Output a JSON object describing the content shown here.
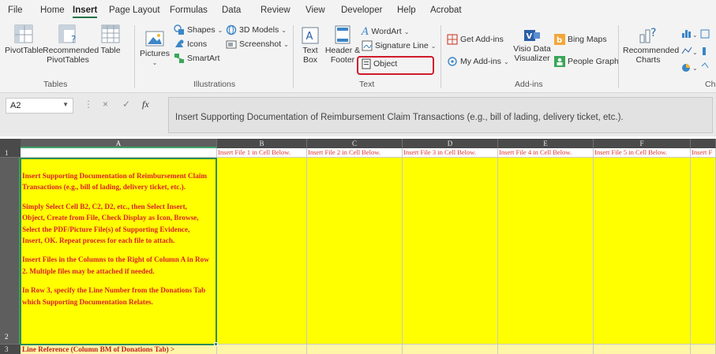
{
  "ribbon_tabs": [
    "File",
    "Home",
    "Insert",
    "Page Layout",
    "Formulas",
    "Data",
    "Review",
    "View",
    "Developer",
    "Help",
    "Acrobat"
  ],
  "active_tab": "Insert",
  "groups": {
    "tables": {
      "label": "Tables",
      "pivottable": "PivotTable",
      "recommended_pivot": "Recommended PivotTables",
      "table": "Table"
    },
    "illustrations": {
      "label": "Illustrations",
      "pictures": "Pictures",
      "shapes": "Shapes",
      "icons": "Icons",
      "models": "3D Models",
      "smartart": "SmartArt",
      "screenshot": "Screenshot"
    },
    "text": {
      "label": "Text",
      "textbox": "Text Box",
      "header_footer": "Header & Footer",
      "wordart": "WordArt",
      "signature_line": "Signature Line",
      "object": "Object"
    },
    "addins": {
      "label": "Add-ins",
      "get_addins": "Get Add-ins",
      "my_addins": "My Add-ins",
      "visio": "Visio Data Visualizer",
      "bing_maps": "Bing Maps",
      "people_graph": "People Graph"
    },
    "charts": {
      "label": "Ch",
      "recommended_charts": "Recommended Charts"
    }
  },
  "name_box": "A2",
  "formula_bar": {
    "cancel": "×",
    "enter": "✓",
    "fx": "fx",
    "content": "Insert Supporting Documentation of  Reimbursement Claim Transactions (e.g., bill of lading, delivery ticket, etc.)."
  },
  "sheet": {
    "column_headers": [
      "A",
      "B",
      "C",
      "D",
      "E",
      "F"
    ],
    "row_headers": [
      "1",
      "2",
      "3"
    ],
    "row1": [
      "",
      "Insert File 1 in Cell Below.",
      "Insert File 2 in Cell Below.",
      "Insert File 3 in Cell Below.",
      "Insert File 4 in Cell Below.",
      "Insert File 5 in Cell Below.",
      "Insert F"
    ],
    "a2_paragraphs": [
      "Insert Supporting Documentation of  Reimbursement Claim Transactions (e.g., bill of lading, delivery ticket, etc.).",
      "Simply Select Cell B2, C2, D2, etc., then Select Insert, Object, Create from File, Check Display as Icon, Browse, Select the PDF/Picture File(s) of Supporting Evidence, Insert, OK.  Repeat process for each file to attach.",
      "Insert Files in the Columns to the Right of Column A in Row 2.  Multiple files may be attached if needed.",
      "In Row 3, specify the Line Number from the Donations Tab which Supporting Documentation Relates."
    ],
    "a3": "Line Reference (Column BM of Donations Tab) >"
  },
  "colors": {
    "accent": "#217346",
    "highlight_border": "#d11a2a",
    "cell_yellow": "#ffff00",
    "cell_text_red": "#d9222a"
  }
}
